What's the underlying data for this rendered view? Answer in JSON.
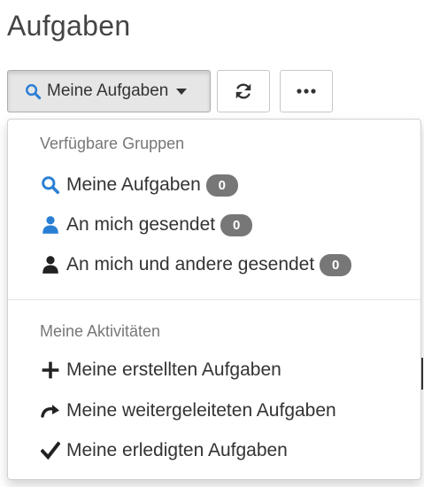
{
  "page": {
    "title": "Aufgaben"
  },
  "toolbar": {
    "groups_button_label": "Meine Aufgaben"
  },
  "menu": {
    "section_groups": {
      "header": "Verfügbare Gruppen",
      "items": [
        {
          "label": "Meine Aufgaben",
          "count": "0",
          "icon": "search-icon",
          "icon_color": "#2a7fd4"
        },
        {
          "label": "An mich gesendet",
          "count": "0",
          "icon": "user-icon",
          "icon_color": "#2a7fd4"
        },
        {
          "label": "An mich und andere gesendet",
          "count": "0",
          "icon": "user-icon",
          "icon_color": "#222222"
        }
      ]
    },
    "section_activities": {
      "header": "Meine Aktivitäten",
      "items": [
        {
          "label": "Meine erstellten Aufgaben",
          "icon": "plus-icon"
        },
        {
          "label": "Meine weitergeleiteten Aufgaben",
          "icon": "forward-icon"
        },
        {
          "label": "Meine erledigten Aufgaben",
          "icon": "check-icon"
        }
      ]
    }
  },
  "colors": {
    "accent_blue": "#2a7fd4",
    "badge_gray": "#777777",
    "header_gray": "#777777"
  }
}
